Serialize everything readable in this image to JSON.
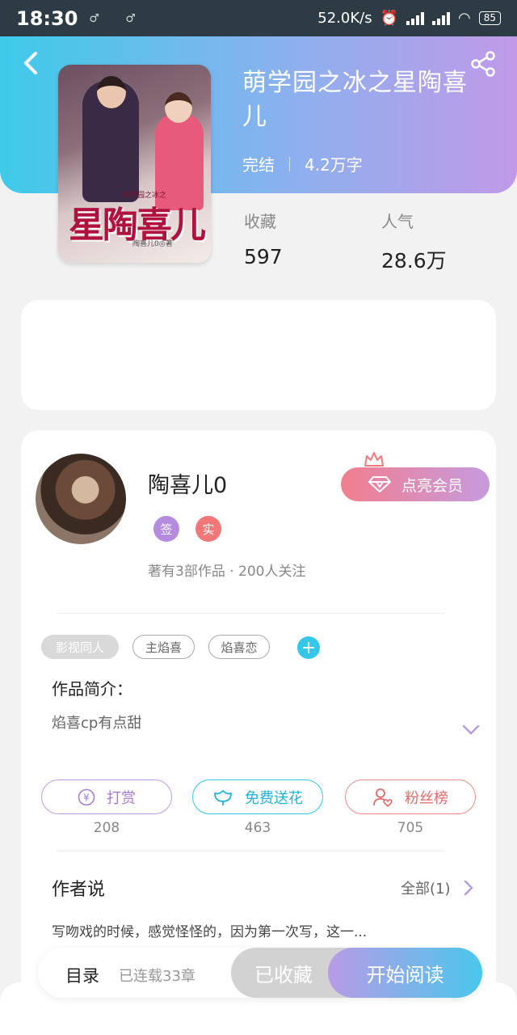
{
  "status_bar": {
    "time": "18:30",
    "left_icons": "♂ ♂",
    "net_speed": "52.0K/s",
    "battery": "85"
  },
  "book": {
    "title": "萌学园之冰之星陶喜儿",
    "status": "完结",
    "word_count": "4.2万字",
    "cover": {
      "title": "星陶喜儿",
      "series": "萌学园之冰之",
      "author_line": "陶喜儿0◎著"
    }
  },
  "stats": {
    "favorites_label": "收藏",
    "favorites_value": "597",
    "popularity_label": "人气",
    "popularity_value": "28.6万"
  },
  "author": {
    "name": "陶喜儿0",
    "badges": [
      "签",
      "实"
    ],
    "summary": "著有3部作品 · 200人关注",
    "vip_label": "点亮会员"
  },
  "tags": [
    "影视同人",
    "主焰喜",
    "焰喜恋"
  ],
  "tag_add": "+",
  "intro": {
    "label": "作品简介：",
    "text": "焰喜cp有点甜"
  },
  "actions": [
    {
      "label": "打赏",
      "count": "208"
    },
    {
      "label": "免费送花",
      "count": "463"
    },
    {
      "label": "粉丝榜",
      "count": "705"
    }
  ],
  "author_says": {
    "label": "作者说",
    "all_label": "全部(1)",
    "text": "写吻戏的时候，感觉怪怪的，因为第一次写，这一..."
  },
  "bottom_bar": {
    "toc_label": "目录",
    "serial_text": "已连载33章",
    "collected_label": "已收藏",
    "read_label": "开始阅读"
  },
  "colors": {
    "hero_start": "#3ecbe9",
    "hero_end": "#c19ae8",
    "accent_cyan": "#34c7ea",
    "accent_purple": "#c49ae6",
    "accent_red": "#ef8a8a"
  }
}
